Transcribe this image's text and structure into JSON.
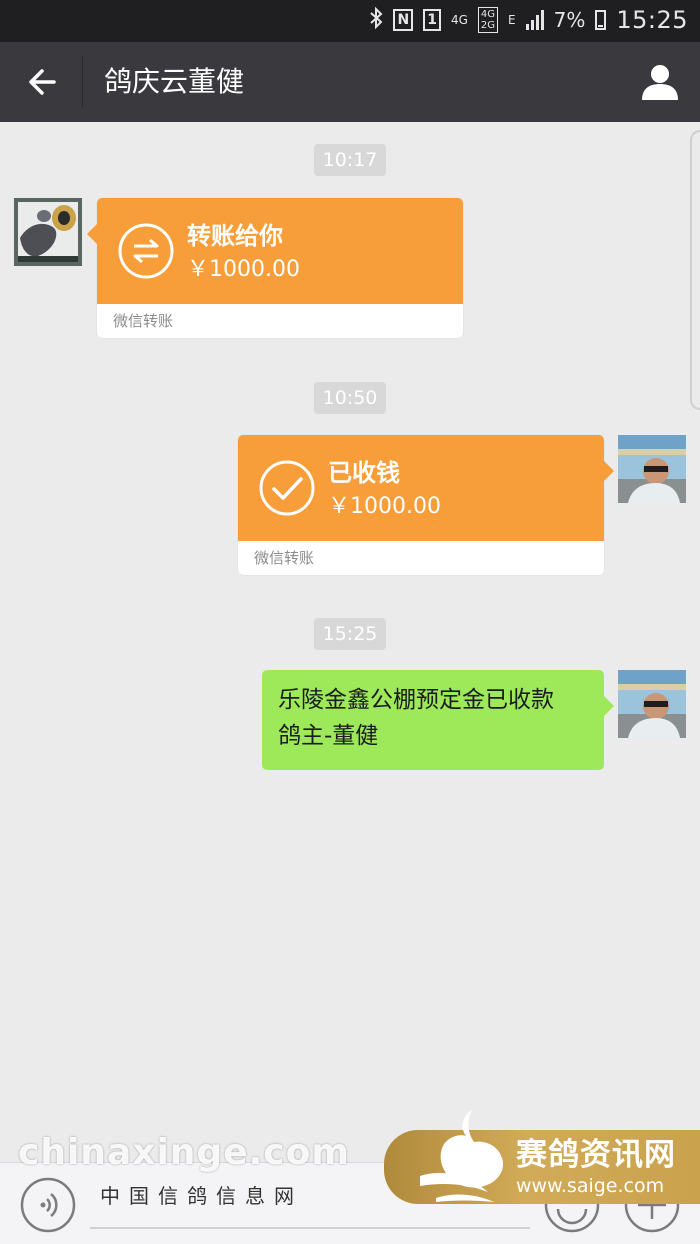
{
  "status_bar": {
    "icons": [
      "bluetooth-icon",
      "nfc-icon",
      "sim1-icon",
      "4g-icon",
      "network-icon",
      "e-icon",
      "signal-icon",
      "battery-icon"
    ],
    "network_top": "4G",
    "network_bottom": "2G",
    "sim": "1",
    "nfc": "N",
    "edge": "E",
    "battery": "7%",
    "time": "15:25"
  },
  "header": {
    "title": "鸽庆云董健"
  },
  "messages": [
    {
      "time": "10:17",
      "type": "transfer",
      "side": "left",
      "title": "转账给你",
      "amount": "￥1000.00",
      "footer": "微信转账"
    },
    {
      "time": "10:50",
      "type": "transfer",
      "side": "right",
      "title": "已收钱",
      "amount": "￥1000.00",
      "footer": "微信转账"
    },
    {
      "time": "15:25",
      "type": "text",
      "side": "right",
      "line1": "乐陵金鑫公棚预定金已收款",
      "line2": "鸽主-董健"
    }
  ],
  "colors": {
    "transfer_orange": "#f79e3a",
    "message_green": "#9de95a",
    "nav_bg": "#3a3a3e",
    "chat_bg": "#ebebeb"
  },
  "watermark_left": {
    "big": "chinaxinge.com",
    "small": "中国信鸽信息网"
  },
  "watermark_right": {
    "name": "赛鸽资讯网",
    "url": "www.saige.com"
  }
}
